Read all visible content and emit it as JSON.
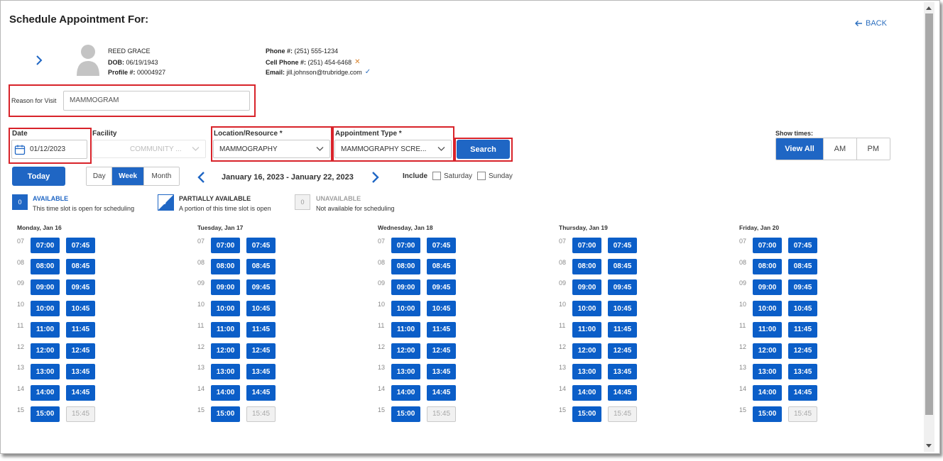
{
  "header": {
    "title": "Schedule Appointment For:",
    "back_label": "BACK"
  },
  "patient": {
    "name": "REED  GRACE",
    "dob_label": "DOB:",
    "dob": "06/19/1943",
    "profile_label": "Profile #:",
    "profile": "00004927"
  },
  "contact": {
    "phone_label": "Phone #:",
    "phone": "(251) 555-1234",
    "cell_label": "Cell Phone #:",
    "cell": "(251) 454-6468",
    "email_label": "Email:",
    "email": "jill.johnson@trubridge.com"
  },
  "reason": {
    "label": "Reason for Visit",
    "value": "MAMMOGRAM"
  },
  "filters": {
    "date_label": "Date",
    "date_value": "01/12/2023",
    "facility_label": "Facility",
    "facility_value": "COMMUNITY ...",
    "location_label": "Location/Resource *",
    "location_value": "MAMMOGRAPHY",
    "appt_type_label": "Appointment Type *",
    "appt_type_value": "MAMMOGRAPHY SCRE...",
    "search_label": "Search"
  },
  "show_times": {
    "label": "Show times:",
    "options": [
      "View All",
      "AM",
      "PM"
    ],
    "selected": "View All"
  },
  "view": {
    "today_label": "Today",
    "modes": [
      "Day",
      "Week",
      "Month"
    ],
    "selected": "Week",
    "range": "January 16, 2023 - January 22, 2023",
    "include_label": "Include",
    "saturday_label": "Saturday",
    "sunday_label": "Sunday"
  },
  "legend": {
    "available": {
      "count": "0",
      "title": "AVAILABLE",
      "desc": "This time slot is open for scheduling"
    },
    "partial": {
      "count": "0",
      "title": "PARTIALLY AVAILABLE",
      "desc": "A portion of this time slot is open"
    },
    "unavailable": {
      "count": "0",
      "title": "UNAVAILABLE",
      "desc": "Not available for scheduling"
    }
  },
  "colors": {
    "primary": "#1f66c4",
    "slot": "#0b5ec8",
    "highlight": "#d8232a",
    "available_title": "#1f66c4",
    "unavailable_title": "#a0a0a0"
  },
  "hours": [
    "07",
    "08",
    "09",
    "10",
    "11",
    "12",
    "13",
    "14",
    "15"
  ],
  "days": [
    {
      "label": "Monday, Jan 16"
    },
    {
      "label": "Tuesday, Jan 17"
    },
    {
      "label": "Wednesday, Jan 18"
    },
    {
      "label": "Thursday, Jan 19"
    },
    {
      "label": "Friday, Jan 20"
    }
  ],
  "slots": [
    [
      "07:00",
      "07:45"
    ],
    [
      "08:00",
      "08:45"
    ],
    [
      "09:00",
      "09:45"
    ],
    [
      "10:00",
      "10:45"
    ],
    [
      "11:00",
      "11:45"
    ],
    [
      "12:00",
      "12:45"
    ],
    [
      "13:00",
      "13:45"
    ],
    [
      "14:00",
      "14:45"
    ],
    [
      "15:00",
      "15:45"
    ]
  ],
  "unavailable_slots": [
    "15:45"
  ]
}
